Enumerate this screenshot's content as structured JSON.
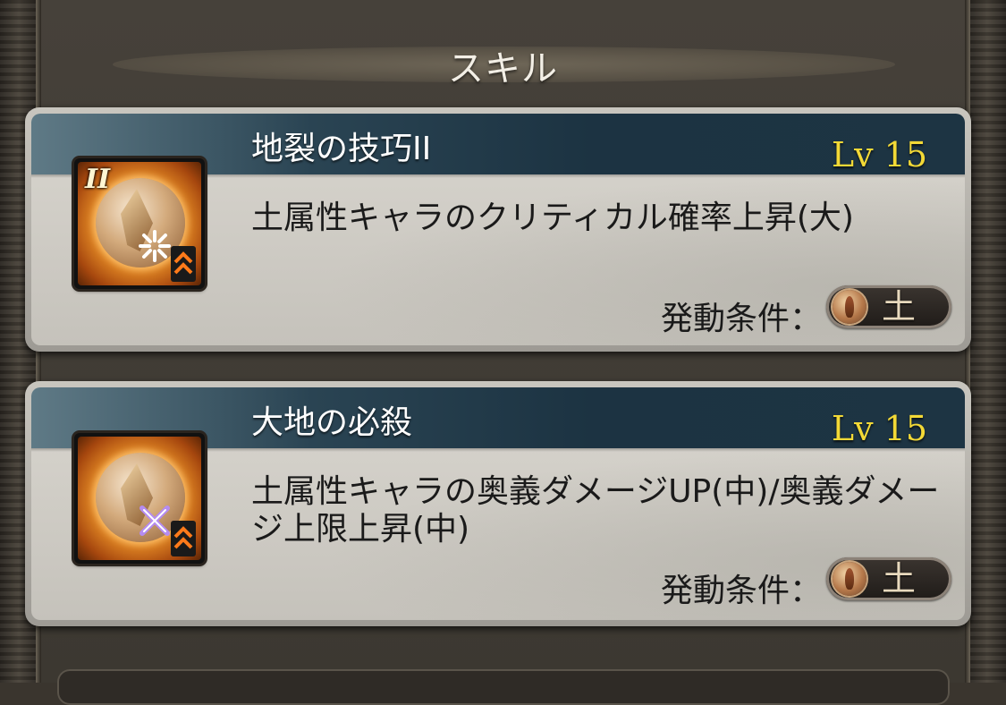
{
  "header": {
    "title": "スキル"
  },
  "skills": [
    {
      "name": "地裂の技巧II",
      "level": "Lv 15",
      "description": "土属性キャラのクリティカル確率上昇(大)",
      "condition_label": "発動条件：",
      "element": "土",
      "icon": "earth-skill-critical-icon",
      "icon_numeral": "II"
    },
    {
      "name": "大地の必殺",
      "level": "Lv 15",
      "description": "土属性キャラの奥義ダメージUP(中)/奥義ダメージ上限上昇(中)",
      "condition_label": "発動条件：",
      "element": "土",
      "icon": "earth-skill-ougi-icon"
    }
  ],
  "colors": {
    "level_text": "#f3d936",
    "band": "#1c3342",
    "card": "#d0cdc6"
  }
}
